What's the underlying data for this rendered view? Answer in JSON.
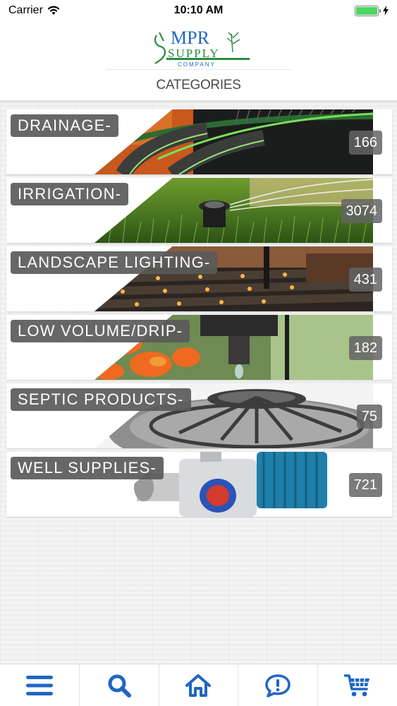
{
  "status_bar": {
    "carrier": "Carrier",
    "time": "10:10 AM"
  },
  "header": {
    "logo": {
      "main": "MPR",
      "line2": "SUPPLY",
      "line3": "COMPANY"
    },
    "title": "CATEGORIES"
  },
  "categories": [
    {
      "label": "DRAINAGE-",
      "count": "166"
    },
    {
      "label": "IRRIGATION-",
      "count": "3074"
    },
    {
      "label": "LANDSCAPE LIGHTING-",
      "count": "431"
    },
    {
      "label": "LOW VOLUME/DRIP-",
      "count": "182"
    },
    {
      "label": "SEPTIC PRODUCTS-",
      "count": "75"
    },
    {
      "label": "WELL SUPPLIES-",
      "count": "721"
    }
  ],
  "tab_bar": {
    "tabs": [
      {
        "icon": "menu-icon"
      },
      {
        "icon": "search-icon"
      },
      {
        "icon": "home-icon"
      },
      {
        "icon": "chat-icon"
      },
      {
        "icon": "cart-icon"
      }
    ]
  },
  "colors": {
    "tab_icon": "#1f66c4",
    "badge_bg": "#5a5a5a",
    "battery": "#4cd964"
  }
}
